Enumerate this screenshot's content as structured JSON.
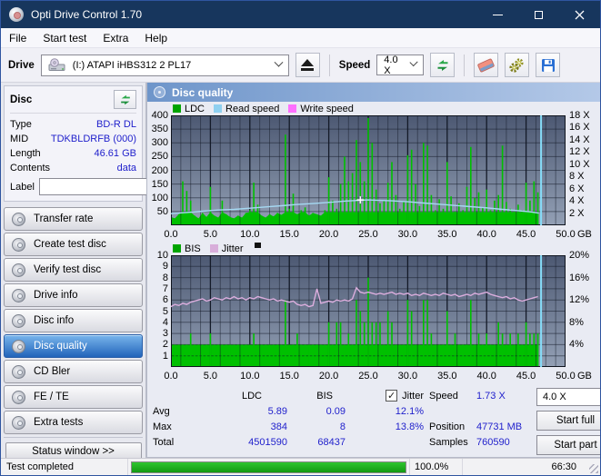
{
  "window": {
    "title": "Opti Drive Control 1.70"
  },
  "menu": [
    "File",
    "Start test",
    "Extra",
    "Help"
  ],
  "toolbar": {
    "drive_label": "Drive",
    "drive_value": "(I:)   ATAPI iHBS312   2 PL17",
    "speed_label": "Speed",
    "speed_value": "4.0 X",
    "icons": [
      "drive-disc-icon",
      "eject-icon",
      "refresh-icon",
      "eraser-icon",
      "gears-icon",
      "save-icon"
    ]
  },
  "sidebar": {
    "disc_panel": {
      "title": "Disc",
      "rows": [
        {
          "label": "Type",
          "value": "BD-R DL"
        },
        {
          "label": "MID",
          "value": "TDKBLDRFB (000)"
        },
        {
          "label": "Length",
          "value": "46.61 GB"
        },
        {
          "label": "Contents",
          "value": "data"
        }
      ],
      "label_label": "Label",
      "label_value": ""
    },
    "nav": [
      {
        "label": "Transfer rate",
        "selected": false
      },
      {
        "label": "Create test disc",
        "selected": false
      },
      {
        "label": "Verify test disc",
        "selected": false
      },
      {
        "label": "Drive info",
        "selected": false
      },
      {
        "label": "Disc info",
        "selected": false
      },
      {
        "label": "Disc quality",
        "selected": true
      },
      {
        "label": "CD Bler",
        "selected": false
      },
      {
        "label": "FE / TE",
        "selected": false
      },
      {
        "label": "Extra tests",
        "selected": false
      }
    ],
    "status_window_label": "Status window >>"
  },
  "main": {
    "header": "Disc quality"
  },
  "chart_data": [
    {
      "type": "bar+line",
      "name": "ldc-read-speed-chart",
      "legend": [
        {
          "label": "LDC",
          "color": "#00a400"
        },
        {
          "label": "Read speed",
          "color": "#8fd0f0"
        },
        {
          "label": "Write speed",
          "color": "#ff70ff"
        }
      ],
      "x_max": 50,
      "x_unit": "GB",
      "x_tick_values": [
        0,
        5,
        10,
        15,
        20,
        25,
        30,
        35,
        40,
        45,
        50
      ],
      "x_ticks": [
        "0.0",
        "5.0",
        "10.0",
        "15.0",
        "20.0",
        "25.0",
        "30.0",
        "35.0",
        "40.0",
        "45.0",
        "50.0"
      ],
      "left_max": 400,
      "left_ticks": [
        400,
        350,
        300,
        250,
        200,
        150,
        100,
        50
      ],
      "right_max": 18,
      "right_ticks": [
        18,
        16,
        14,
        12,
        10,
        8,
        6,
        4,
        2
      ],
      "right_suffix": " X",
      "bar_color": "#00c000",
      "bar_x_step": 0.5,
      "carpet_clip": 48,
      "bars": [
        30,
        25,
        40,
        160,
        125,
        90,
        35,
        25,
        45,
        30,
        140,
        35,
        28,
        90,
        40,
        30,
        25,
        35,
        28,
        45,
        55,
        155,
        75,
        35,
        28,
        40,
        32,
        45,
        38,
        330,
        60,
        115,
        40,
        55,
        65,
        35,
        45,
        40,
        35,
        55,
        175,
        90,
        60,
        150,
        250,
        160,
        190,
        310,
        230,
        160,
        390,
        300,
        130,
        80,
        90,
        155,
        230,
        110,
        60,
        85,
        255,
        275,
        150,
        70,
        300,
        290,
        110,
        55,
        95,
        60,
        230,
        105,
        50,
        80,
        55,
        140,
        285,
        100,
        120,
        65,
        130,
        55,
        90,
        110,
        290,
        85,
        60,
        50,
        75,
        55,
        155,
        90,
        160,
        120
      ],
      "line_axis": "right",
      "line_color": "#a5d9f2",
      "line_points": [
        [
          0,
          1.9
        ],
        [
          2,
          2.1
        ],
        [
          4,
          2.3
        ],
        [
          6,
          2.5
        ],
        [
          8,
          2.6
        ],
        [
          10,
          2.8
        ],
        [
          12,
          3.0
        ],
        [
          14,
          3.2
        ],
        [
          16,
          3.4
        ],
        [
          18,
          3.55
        ],
        [
          20,
          3.75
        ],
        [
          22,
          3.95
        ],
        [
          24,
          4.1
        ],
        [
          25,
          4.15
        ],
        [
          26,
          4.1
        ],
        [
          28,
          4.0
        ],
        [
          30,
          3.85
        ],
        [
          32,
          3.65
        ],
        [
          34,
          3.45
        ],
        [
          36,
          3.25
        ],
        [
          38,
          3.05
        ],
        [
          40,
          2.85
        ],
        [
          42,
          2.6
        ],
        [
          44,
          2.4
        ],
        [
          45.5,
          2.2
        ],
        [
          46.6,
          2.0
        ]
      ],
      "cursor": {
        "x": 24.0,
        "v": 4.15
      },
      "end_marker_x": 46.9,
      "end_marker_color": "#86dcf8"
    },
    {
      "type": "bar+line",
      "name": "bis-jitter-chart",
      "legend": [
        {
          "label": "BIS",
          "color": "#00a400"
        },
        {
          "label": "Jitter",
          "color": "#d8aeda"
        }
      ],
      "extra_icon": "black-square-marker",
      "x_max": 50,
      "x_unit": "GB",
      "x_tick_values": [
        0,
        5,
        10,
        15,
        20,
        25,
        30,
        35,
        40,
        45,
        50
      ],
      "x_ticks": [
        "0.0",
        "5.0",
        "10.0",
        "15.0",
        "20.0",
        "25.0",
        "30.0",
        "35.0",
        "40.0",
        "45.0",
        "50.0"
      ],
      "left_max": 10,
      "left_ticks": [
        10,
        9,
        8,
        7,
        6,
        5,
        4,
        3,
        2,
        1
      ],
      "right_max": 20,
      "right_ticks": [
        20,
        16,
        12,
        8,
        4
      ],
      "right_suffix": "%",
      "bar_color": "#00c000",
      "bar_x_step": 0.5,
      "baseline": 2,
      "bars": [
        2,
        2,
        2,
        2,
        2,
        3,
        2,
        2,
        2,
        2,
        3,
        2,
        2,
        2,
        2,
        2,
        2,
        2,
        2,
        2,
        2,
        3,
        2,
        2,
        2,
        2,
        2,
        2,
        2,
        6,
        2,
        2,
        3,
        2,
        2,
        2,
        2,
        2,
        2,
        2,
        4,
        2,
        4,
        4,
        2,
        3,
        2,
        6,
        5,
        4,
        8,
        4,
        4,
        4,
        2,
        5,
        4,
        2,
        2,
        2,
        6,
        5,
        2,
        2,
        6,
        6,
        3,
        2,
        2,
        2,
        5,
        2,
        3,
        2,
        2,
        2,
        6,
        2,
        3,
        2,
        3,
        2,
        2,
        4,
        3,
        2,
        3,
        2,
        3,
        2,
        4,
        3,
        3,
        3
      ],
      "line_axis": "left",
      "line_color": "#dcaede",
      "line_x_step": 0.5,
      "line_values": [
        5.4,
        5.6,
        5.5,
        5.7,
        5.6,
        5.8,
        5.9,
        6.0,
        6.1,
        5.9,
        6.0,
        6.2,
        6.1,
        6.0,
        6.2,
        6.1,
        6.3,
        6.1,
        6.2,
        6.0,
        6.2,
        6.1,
        6.3,
        6.2,
        6.1,
        6.0,
        6.1,
        5.9,
        6.0,
        5.9,
        5.8,
        5.9,
        5.6,
        5.5,
        5.6,
        5.4,
        5.5,
        7.0,
        5.7,
        5.8,
        5.9,
        5.8,
        6.0,
        5.9,
        6.0,
        5.9,
        6.1,
        7.1,
        6.7,
        6.6,
        6.7,
        6.6,
        6.5,
        6.6,
        6.5,
        6.6,
        6.7,
        6.5,
        6.6,
        6.5,
        6.6,
        6.4,
        6.5,
        6.4,
        6.6,
        6.5,
        6.4,
        6.5,
        6.4,
        6.6,
        6.5,
        6.4,
        6.5,
        6.3,
        6.4,
        6.5,
        6.4,
        6.6,
        6.5,
        6.6,
        6.7,
        6.5,
        6.4,
        6.3,
        6.2,
        6.3,
        6.1,
        6.2,
        6.0,
        5.9,
        6.0,
        6.1,
        6.2,
        6.3
      ],
      "end_marker_x": 46.9,
      "end_marker_color": "#86dcf8"
    }
  ],
  "stats": {
    "col_ldc": "LDC",
    "col_bis": "BIS",
    "col_jitter": "Jitter",
    "jitter_checked": true,
    "check_glyph": "✓",
    "rows": [
      {
        "label": "Avg",
        "ldc": "5.89",
        "bis": "0.09",
        "jitter": "12.1%"
      },
      {
        "label": "Max",
        "ldc": "384",
        "bis": "8",
        "jitter": "13.8%"
      },
      {
        "label": "Total",
        "ldc": "4501590",
        "bis": "68437",
        "jitter": ""
      }
    ],
    "speed_label": "Speed",
    "speed_value": "1.73 X",
    "position_label": "Position",
    "position_value": "47731 MB",
    "samples_label": "Samples",
    "samples_value": "760590",
    "speed_select_value": "4.0 X",
    "start_full_label": "Start full",
    "start_part_label": "Start part"
  },
  "statusbar": {
    "status": "Test completed",
    "progress_percent": 100,
    "percent_label": "100.0%",
    "time": "66:30"
  },
  "colors": {
    "titlebar": "#17365d",
    "selected_nav": "#2264ba",
    "value_text": "#2121cc",
    "chart_bg_top": "#4c5872",
    "chart_bg_bottom": "#93a0b5",
    "bars_green": "#00c000",
    "read_speed_line": "#a5d9f2",
    "jitter_line": "#dcaede",
    "end_marker": "#86dcf8",
    "progress_green": "#1fae1f"
  }
}
